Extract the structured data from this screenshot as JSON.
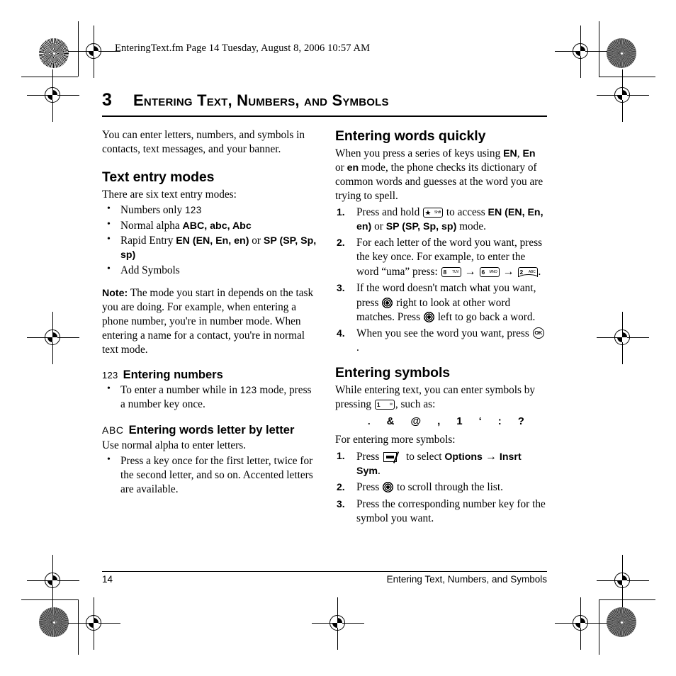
{
  "fm_header": "EnteringText.fm  Page 14  Tuesday, August 8, 2006  10:57 AM",
  "chapter": {
    "number": "3",
    "title": "Entering Text, Numbers, and Symbols"
  },
  "left_column": {
    "intro": "You can enter letters, numbers, and symbols in contacts, text messages, and your banner.",
    "text_entry_modes": {
      "heading": "Text entry modes",
      "lead": "There are six text entry modes:",
      "bullets": [
        {
          "text": "Numbers only ",
          "tag": "123"
        },
        {
          "text": "Normal alpha ",
          "tag": "ABC, abc, Abc"
        },
        {
          "text": "Rapid Entry ",
          "tag": "EN (EN, En, en)",
          "tail": " or ",
          "tag2": "SP (SP, Sp, sp)"
        },
        {
          "text": "Add Symbols"
        }
      ],
      "note_label": "Note:",
      "note_text": "The mode you start in depends on the task you are doing. For example, when entering a phone number, you're in number mode. When entering a name for a contact, you're in normal text mode."
    },
    "entering_numbers": {
      "mode_tag": "123",
      "heading": "Entering numbers",
      "bullet_before": "To enter a number while in ",
      "bullet_tag": "123",
      "bullet_after": " mode, press a number key once."
    },
    "entering_words_letter": {
      "mode_tag": "ABC",
      "heading": "Entering words letter by letter",
      "lead": "Use normal alpha to enter letters.",
      "bullet": "Press a key once for the first letter, twice for the second letter, and so on. Accented letters are available."
    }
  },
  "right_column": {
    "entering_words_quickly": {
      "heading": "Entering words quickly",
      "intro_1": "When you press a series of keys using ",
      "intro_tag_1": "EN",
      "intro_2": ", ",
      "intro_tag_2": "En",
      "intro_3": " or ",
      "intro_tag_3": "en",
      "intro_4": " mode, the phone checks its dictionary of common words and guesses at the word you are trying to spell.",
      "steps": [
        {
          "before": "Press and hold ",
          "icon": "star-key-icon",
          "key_main": "★",
          "key_sub": "Shift",
          "after_1": " to access ",
          "tag_1": "EN (EN, En, en)",
          "after_2": " or ",
          "tag_2": "SP (SP, Sp, sp)",
          "after_3": " mode."
        },
        {
          "before": "For each letter of the word you want, press the key once. For example, to enter the word “uma” press: ",
          "keys": [
            {
              "main": "8",
              "sub": "TUV"
            },
            {
              "main": "6",
              "sub": "MNO"
            },
            {
              "main": "2",
              "sub": "ABC"
            }
          ],
          "arrow": "→",
          "after": "."
        },
        {
          "before": "If the word doesn't match what you want, press ",
          "icon": "nav-ring-icon",
          "middle": " right to look at other word matches. Press ",
          "icon2": "nav-ring-icon",
          "after": " left to go back a word."
        },
        {
          "before": "When you see the word you want, press ",
          "icon": "ok-button-icon",
          "icon_label": "OK",
          "after": " ."
        }
      ]
    },
    "entering_symbols": {
      "heading": "Entering symbols",
      "intro_1": "While entering text, you can enter symbols by pressing ",
      "key_main": "1",
      "key_sub": "✉",
      "intro_2": ", such as:",
      "symbols": [
        ".",
        "&",
        "@",
        ",",
        "1",
        "‘",
        ":",
        "?"
      ],
      "more_lead": "For entering more symbols:",
      "steps": [
        {
          "before": "Press ",
          "icon": "softkey-icon",
          "middle": " to select ",
          "tag_1": "Options",
          "arrow": "→",
          "tag_2": "Insrt Sym",
          "after": "."
        },
        {
          "before": "Press ",
          "icon": "nav-ring-icon",
          "after": " to scroll through the list."
        },
        {
          "before": "Press the corresponding number key for the symbol you want."
        }
      ]
    }
  },
  "footer": {
    "page_number": "14",
    "running_title": "Entering Text, Numbers, and Symbols"
  }
}
